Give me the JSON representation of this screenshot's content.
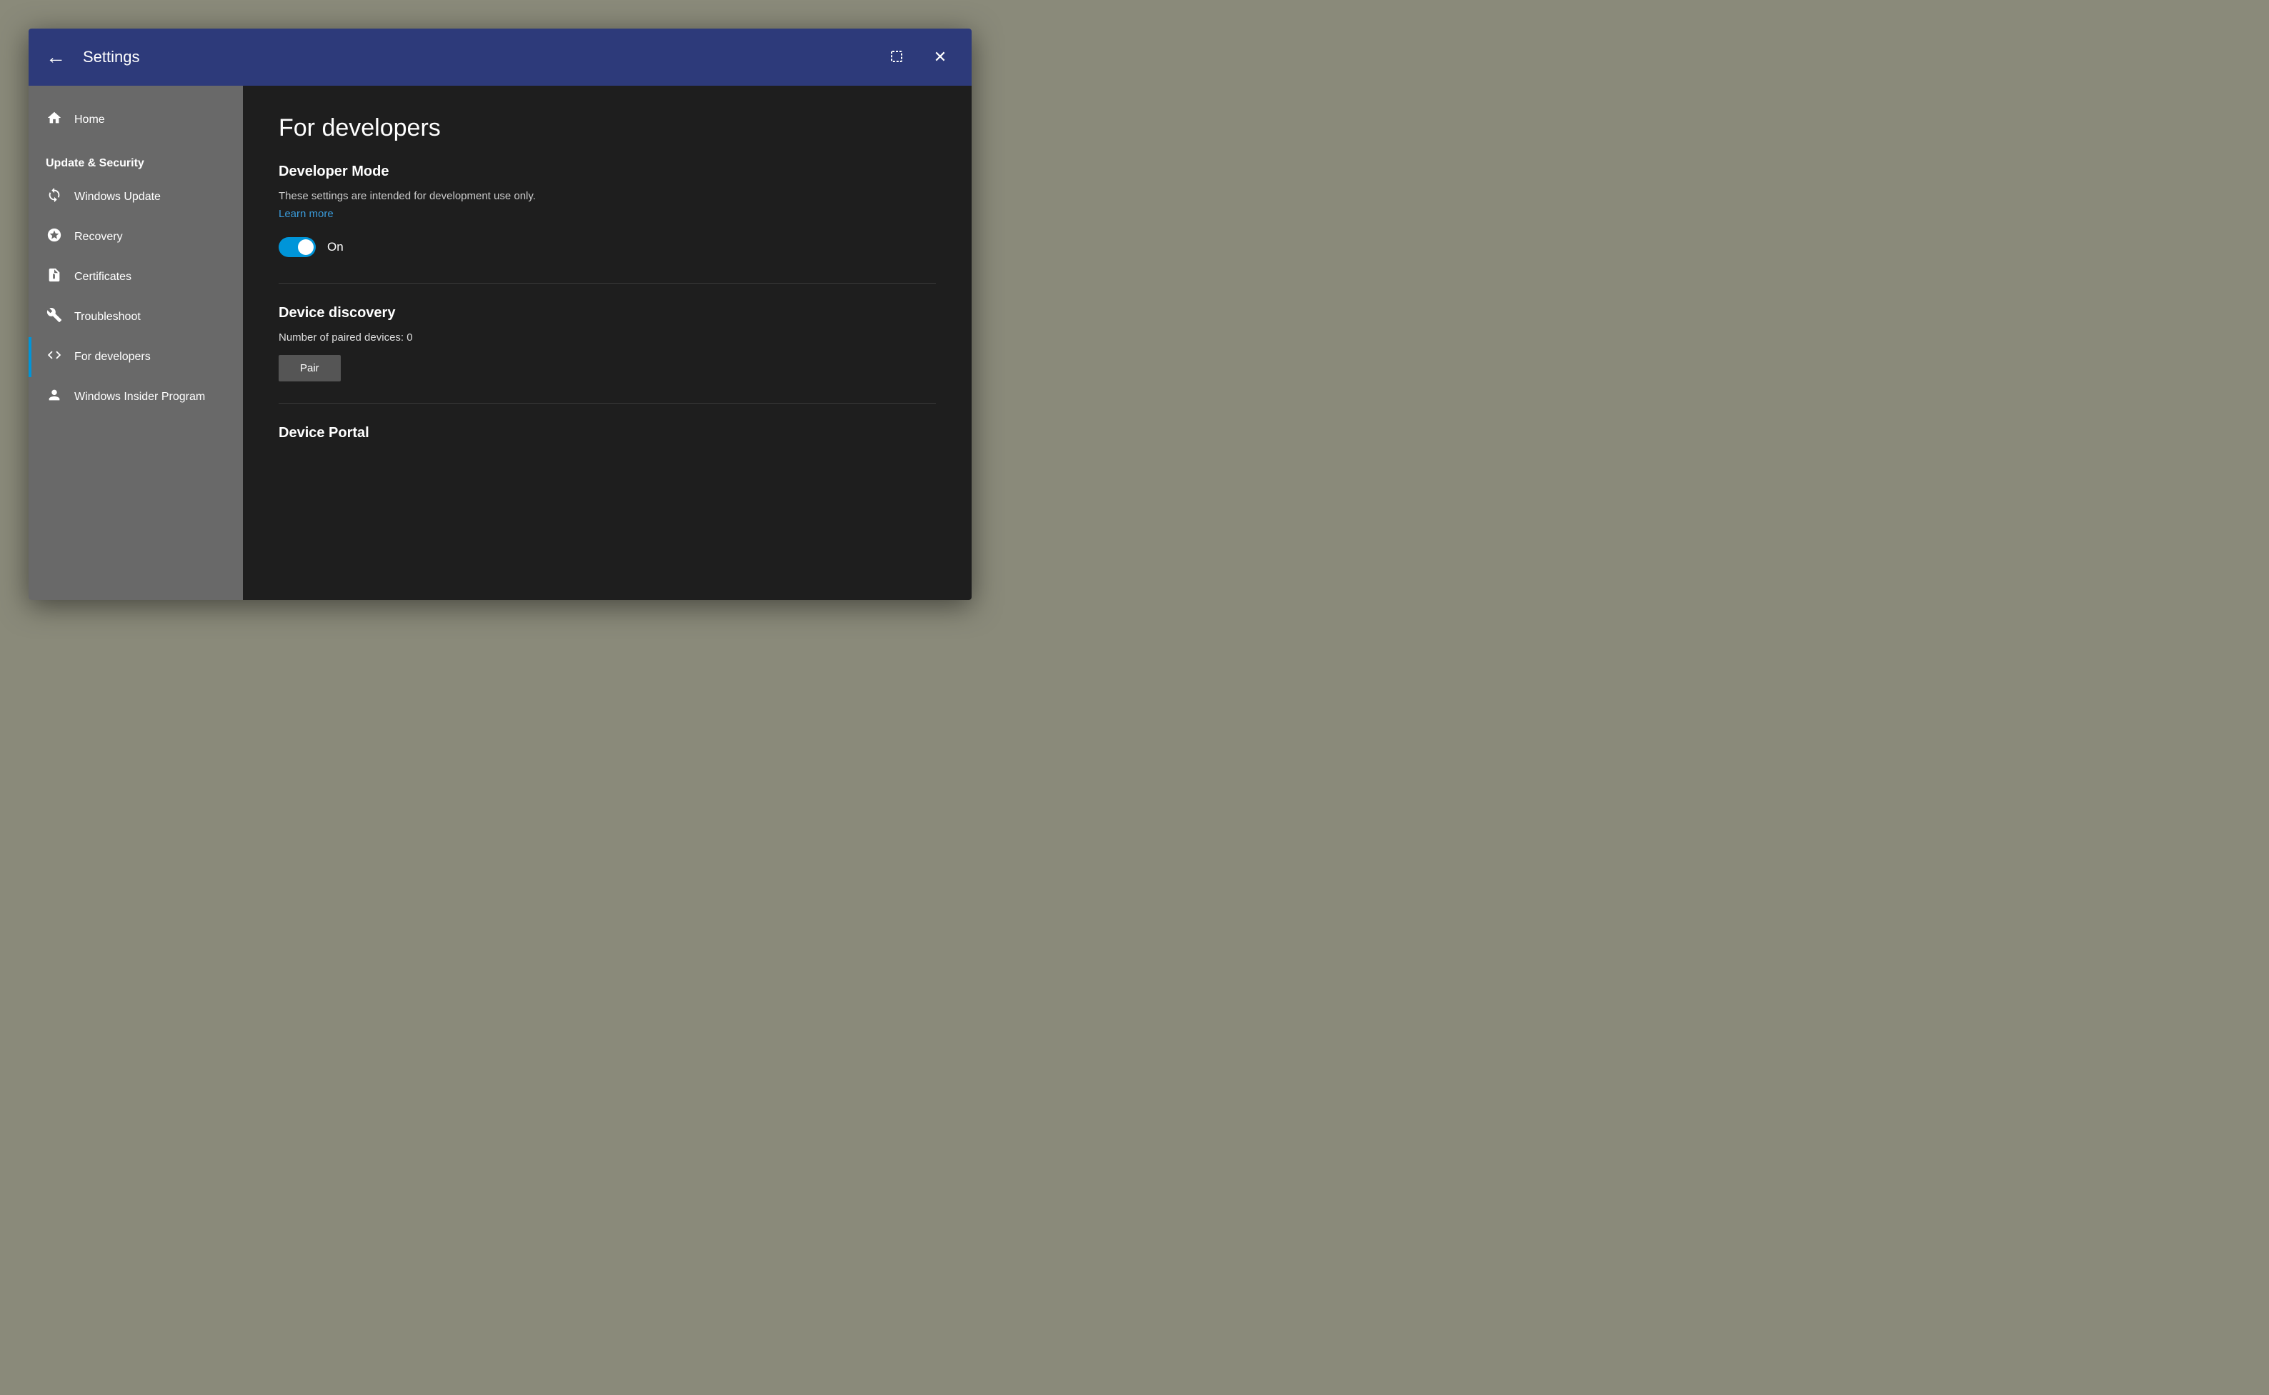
{
  "titlebar": {
    "title": "Settings",
    "back_label": "←",
    "close_label": "✕",
    "restore_label": "❐"
  },
  "sidebar": {
    "home_label": "Home",
    "section_label": "Update & Security",
    "items": [
      {
        "id": "windows-update",
        "label": "Windows Update",
        "icon": "update"
      },
      {
        "id": "recovery",
        "label": "Recovery",
        "icon": "recovery"
      },
      {
        "id": "certificates",
        "label": "Certificates",
        "icon": "certificates"
      },
      {
        "id": "troubleshoot",
        "label": "Troubleshoot",
        "icon": "troubleshoot"
      },
      {
        "id": "for-developers",
        "label": "For developers",
        "icon": "developers",
        "active": true
      },
      {
        "id": "windows-insider",
        "label": "Windows Insider Program",
        "icon": "insider"
      }
    ]
  },
  "main": {
    "page_title": "For developers",
    "developer_mode": {
      "section_title": "Developer Mode",
      "description": "These settings are intended for development use only.",
      "learn_more": "Learn more",
      "toggle_state": "On"
    },
    "device_discovery": {
      "section_title": "Device discovery",
      "paired_devices_label": "Number of paired devices: 0",
      "pair_button_label": "Pair"
    },
    "device_portal": {
      "section_title": "Device Portal"
    }
  }
}
